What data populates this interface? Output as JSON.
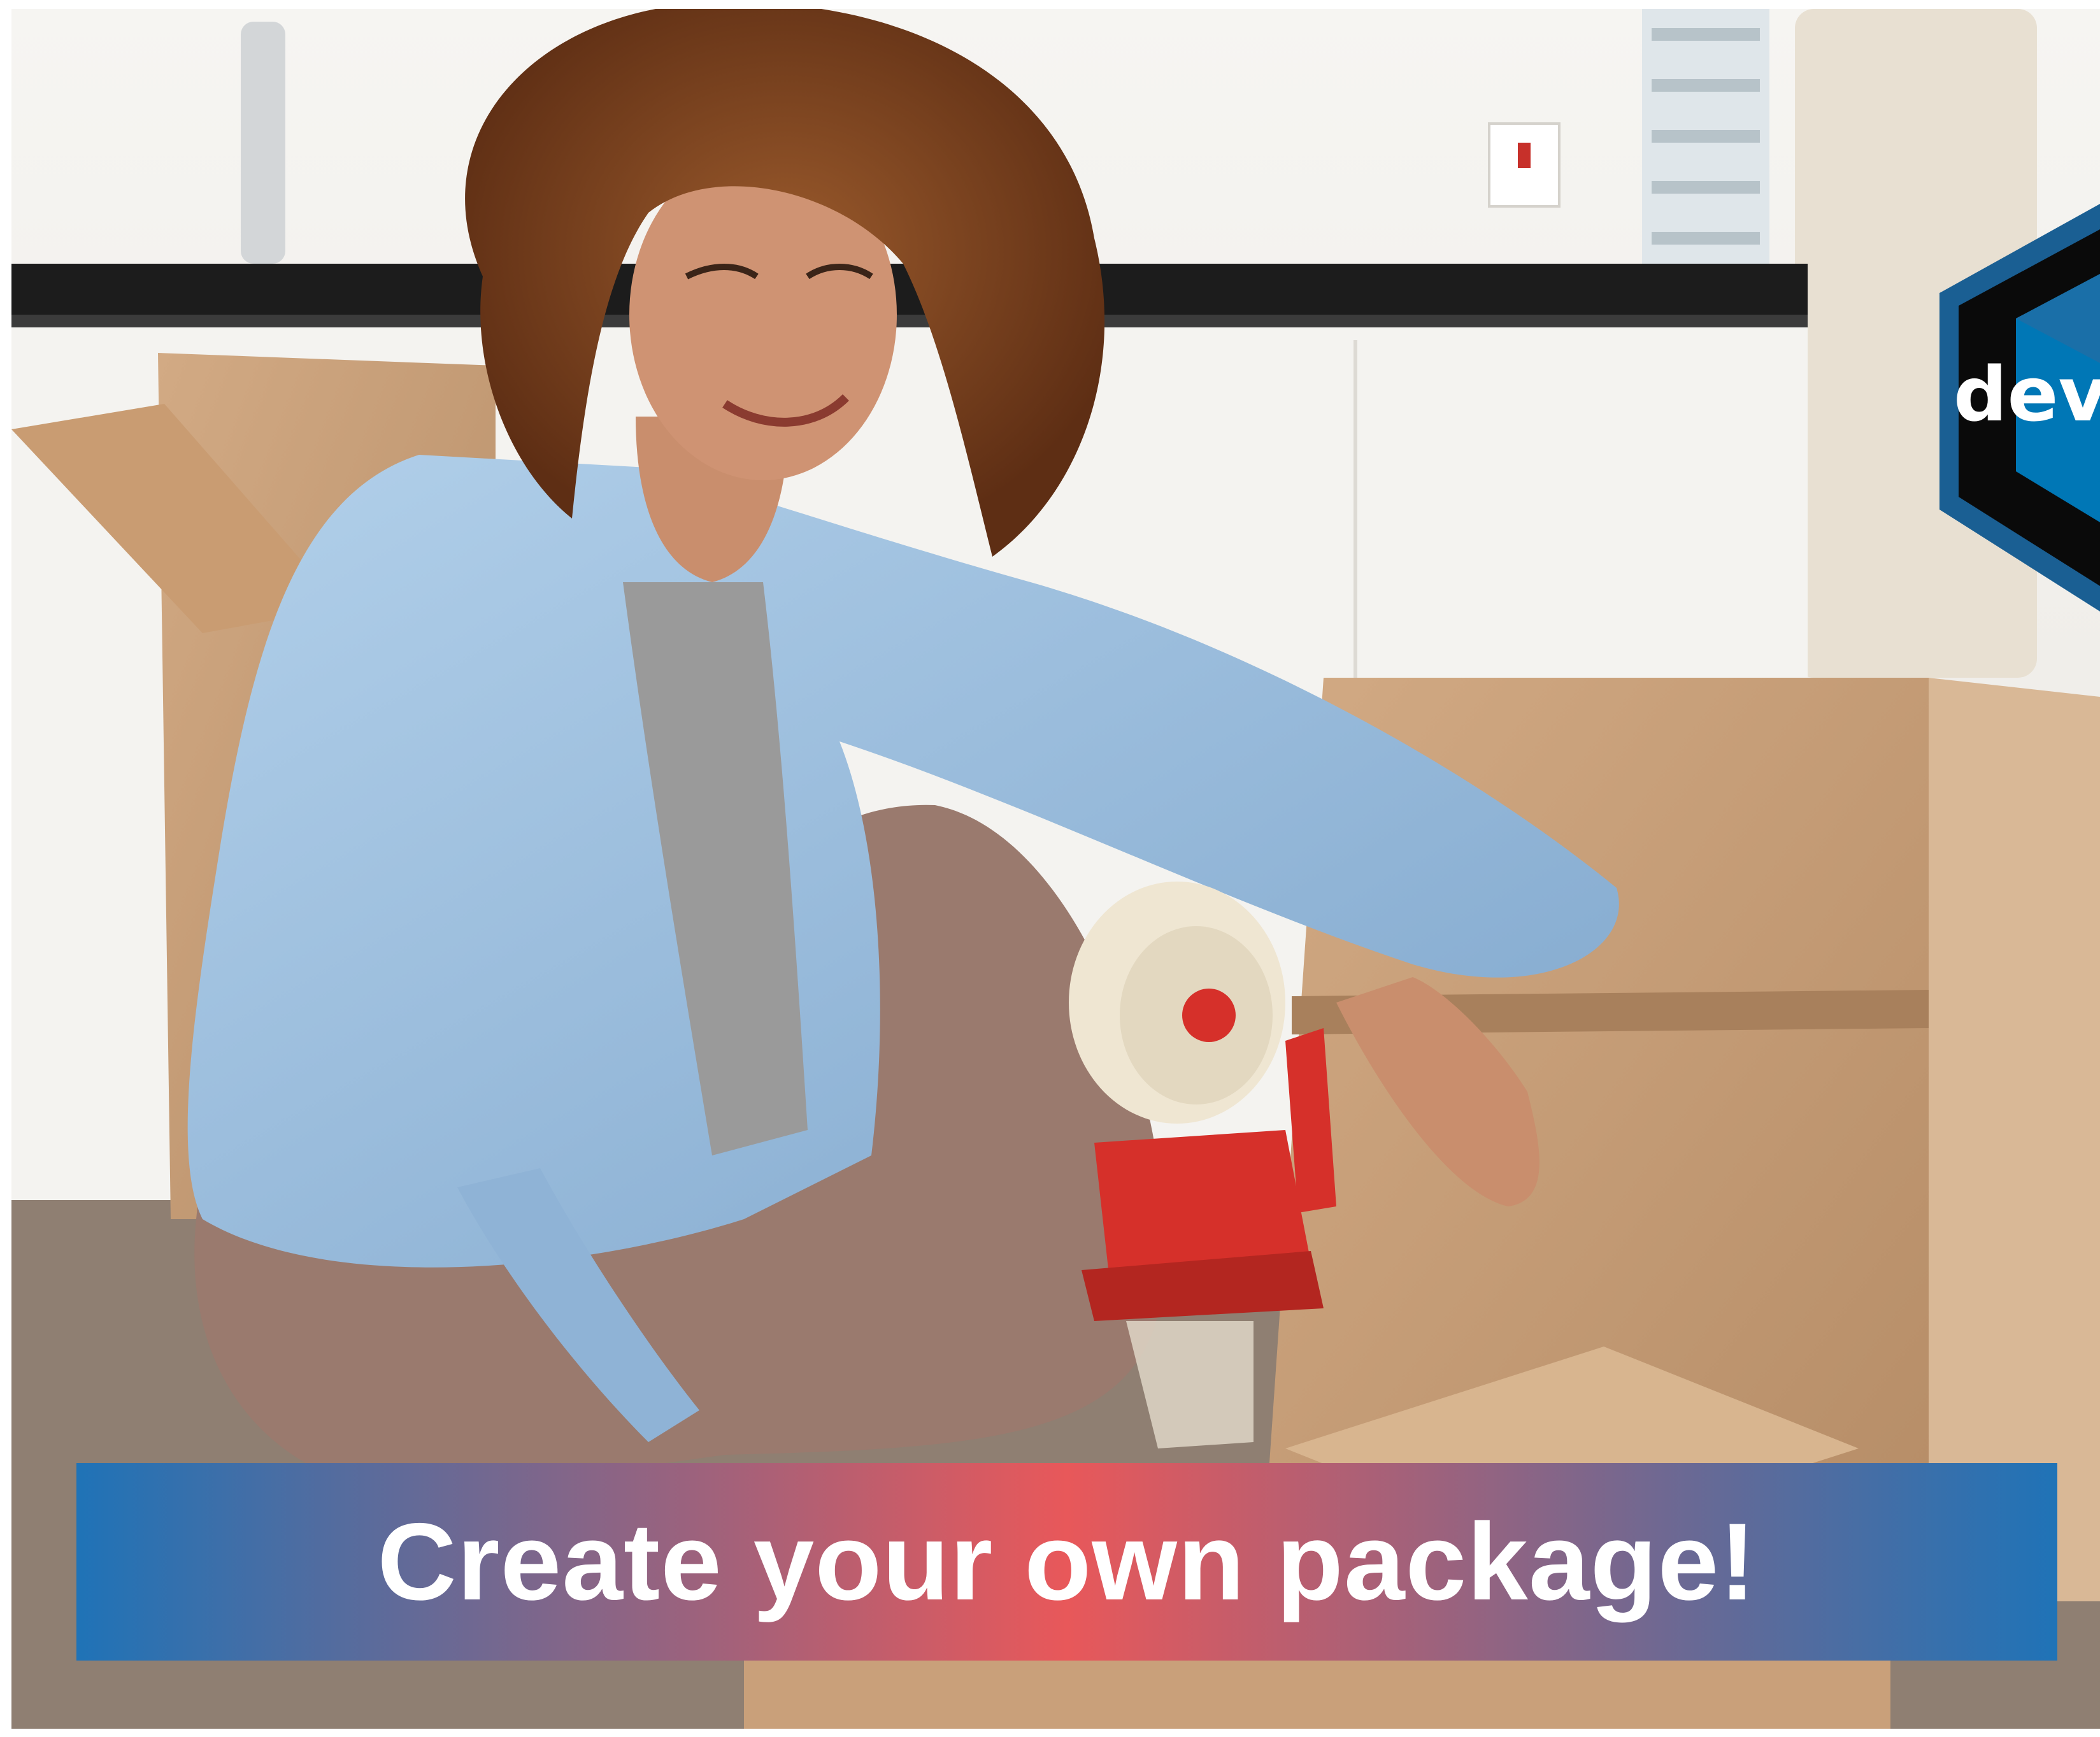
{
  "banner": {
    "text": "Create your own package!",
    "gradient": [
      "#1f73b7",
      "#e8585a",
      "#1f73b7"
    ]
  },
  "logo": {
    "lettering": "dev",
    "icon": "hex-sticker-icon",
    "colors": {
      "outer": "#1a5f93",
      "inner": "#0077b6",
      "dark": "#0a0a0a"
    }
  },
  "photo": {
    "icon": "photo-woman-packing-boxes",
    "palette": {
      "wall": "#f2f0ec",
      "counter": "#1c1c1c",
      "floor": "#8f7f72",
      "cardboard": "#c9a07a",
      "cardboard_shadow": "#a8805c",
      "shirt": "#9ec0de",
      "pants": "#9a7a6e",
      "hair": "#8a4a22",
      "skin": "#c98e6d",
      "tape_dispenser": "#d6302a",
      "tape": "#efe6d2"
    }
  }
}
